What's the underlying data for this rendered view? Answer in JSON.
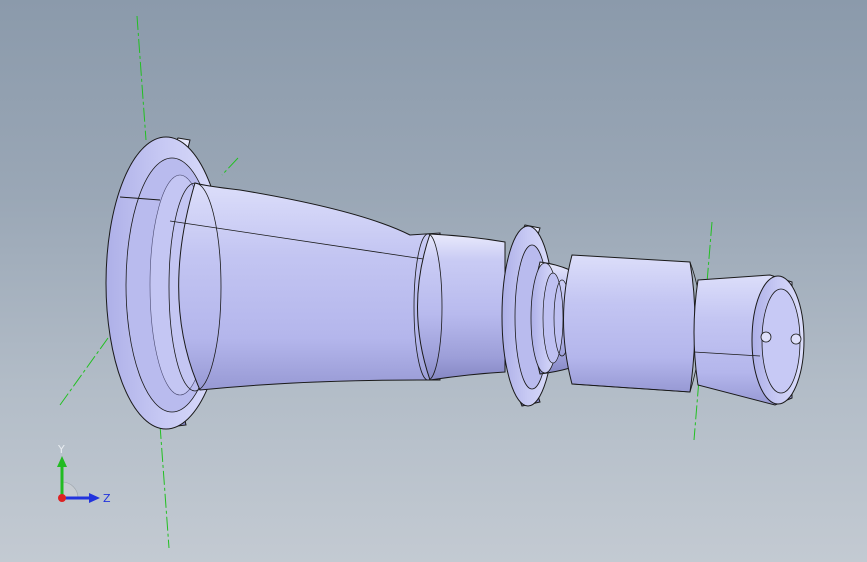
{
  "viewport": {
    "background_top": "#8b9aab",
    "background_bottom": "#c3cad2"
  },
  "model": {
    "part_color": "#c6c8f2",
    "shadow_color": "#7f80b8",
    "edge_color": "#1a1a1a",
    "centerline_color": "#22c022"
  },
  "triad": {
    "y_label": "Y",
    "z_label": "Z",
    "y_axis_color": "#22bb22",
    "z_axis_color": "#2233dd",
    "x_axis_color": "#dd2222"
  }
}
